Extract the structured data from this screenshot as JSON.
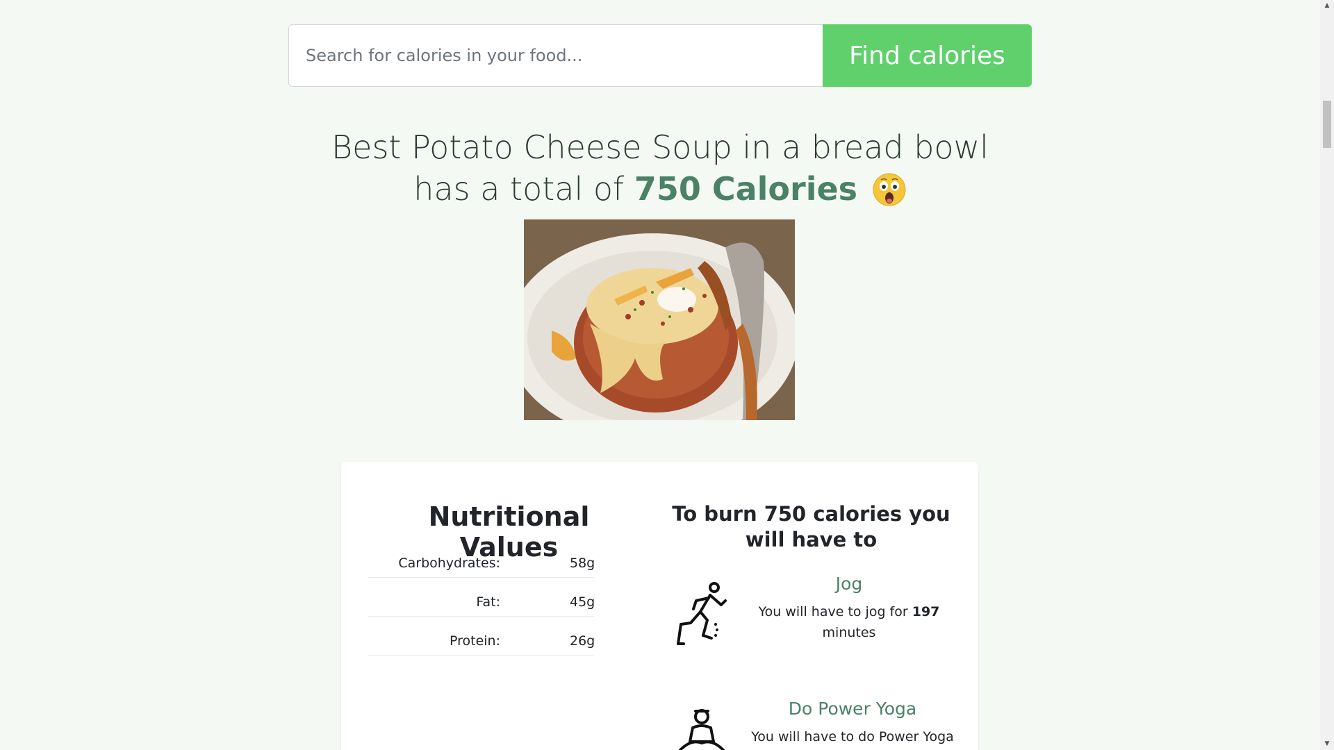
{
  "search": {
    "placeholder": "Search for calories in your food...",
    "button_label": "Find calories"
  },
  "headline": {
    "prefix": "Best Potato Cheese Soup in a bread bowl has a total of",
    "calories": "750 Calories",
    "emoji": "astonished-face"
  },
  "nutrition": {
    "title": "Nutritional Values",
    "rows": [
      {
        "label": "Carbohydrates:",
        "value": "58g"
      },
      {
        "label": "Fat:",
        "value": "45g"
      },
      {
        "label": "Protein:",
        "value": "26g"
      }
    ]
  },
  "burn": {
    "title": "To burn 750 calories you will have to",
    "activities": [
      {
        "name": "Jog",
        "text_before": "You will have to jog for",
        "minutes": "197",
        "text_after": "minutes",
        "icon": "jogging-icon"
      },
      {
        "name": "Do Power Yoga",
        "text_before": "You will have to do Power Yoga",
        "icon": "yoga-icon"
      }
    ]
  },
  "colors": {
    "page_bg": "#f4f9f4",
    "accent_green": "#5fd06b",
    "calorie_green": "#4b8266"
  }
}
